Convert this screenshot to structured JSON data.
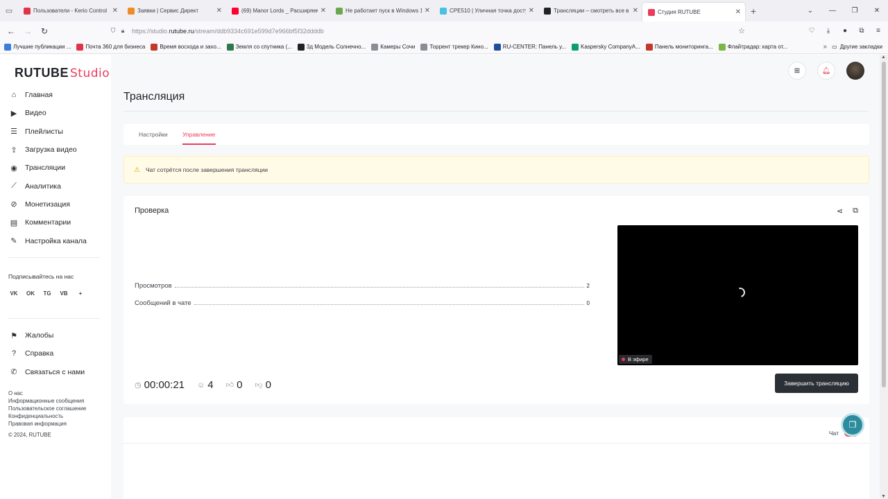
{
  "browser": {
    "tabs": [
      {
        "title": "Пользователи - Kerio Control",
        "color": "#e0334a"
      },
      {
        "title": "Заявки | Сервис Директ",
        "color": "#f08c28"
      },
      {
        "title": "(69) Manor Lords _ Расширяем",
        "color": "#ff0033"
      },
      {
        "title": "Не работает пуск в Windows 1",
        "color": "#6aa84f"
      },
      {
        "title": "CPE510 | Уличная точка досту",
        "color": "#4ac1e0"
      },
      {
        "title": "Трансляции – смотреть все в",
        "color": "#1f2226"
      },
      {
        "title": "Студия RUTUBE",
        "color": "#ea3b5b",
        "active": true
      }
    ],
    "url_prefix": "https://studio.",
    "url_domain": "rutube.ru",
    "url_path": "/stream/ddb9334c691e599d7e966bf5f32ddddb",
    "bookmarks": [
      {
        "label": "Лучшие публикации ...",
        "color": "#3b7dd8"
      },
      {
        "label": "Почта 360 для бизнеса",
        "color": "#e0334a"
      },
      {
        "label": "Время восхода и захо...",
        "color": "#c0392b"
      },
      {
        "label": "Земля со спутника (...",
        "color": "#2c7a4b"
      },
      {
        "label": "3д Модель Солнечно...",
        "color": "#1f2226"
      },
      {
        "label": "Камеры Сочи",
        "color": "#8a8d93"
      },
      {
        "label": "Торрент трекер Кино...",
        "color": "#8a8d93"
      },
      {
        "label": "RU-CENTER: Панель у...",
        "color": "#1c4e9a"
      },
      {
        "label": "Kaspersky CompanyA...",
        "color": "#0a9e6e"
      },
      {
        "label": "Панель мониторинга...",
        "color": "#c0392b"
      },
      {
        "label": "Флайтрадар: карта от...",
        "color": "#7ab648"
      }
    ],
    "other_bookmarks": "Другие закладки"
  },
  "logo": {
    "part1": "RUTUBE",
    "part2": "Studio"
  },
  "sidebar": {
    "menu": [
      {
        "label": "Главная",
        "icon": "home-icon"
      },
      {
        "label": "Видео",
        "icon": "video-icon"
      },
      {
        "label": "Плейлисты",
        "icon": "playlist-icon"
      },
      {
        "label": "Загрузка видео",
        "icon": "upload-icon"
      },
      {
        "label": "Трансляции",
        "icon": "broadcast-icon"
      },
      {
        "label": "Аналитика",
        "icon": "analytics-icon"
      },
      {
        "label": "Монетизация",
        "icon": "money-icon"
      },
      {
        "label": "Комментарии",
        "icon": "comments-icon"
      },
      {
        "label": "Настройка канала",
        "icon": "wand-icon"
      }
    ],
    "social_title": "Подписывайтесь на нас",
    "socials": [
      "VK",
      "OK",
      "TG",
      "VB",
      "+"
    ],
    "menu2": [
      {
        "label": "Жалобы",
        "icon": "flag-icon"
      },
      {
        "label": "Справка",
        "icon": "help-icon"
      },
      {
        "label": "Связаться с нами",
        "icon": "contact-icon"
      }
    ],
    "footer_links": [
      "О нас",
      "Информационные сообщения",
      "Пользовательское соглашение",
      "Конфиденциальность",
      "Правовая информация"
    ],
    "copyright": "© 2024, RUTUBE"
  },
  "page": {
    "title": "Трансляция",
    "tabs": [
      {
        "label": "Настройки"
      },
      {
        "label": "Управление",
        "active": true
      }
    ],
    "warning": "Чат сотрётся после завершения трансляции",
    "card_title": "Проверка",
    "stats": [
      {
        "label": "Просмотров",
        "value": "2"
      },
      {
        "label": "Сообщений в чате",
        "value": "0"
      }
    ],
    "live_badge": "В эфире",
    "timer": "00:00:21",
    "viewers": "4",
    "likes": "0",
    "dislikes": "0",
    "end_button": "Завершить трансляцию",
    "chat_label": "Чат",
    "chat_enabled": true
  },
  "colors": {
    "accent": "#ea3b5b",
    "dark_button": "#2b2f36",
    "warning_bg": "#fffbe6",
    "fab": "#2c8c9d"
  }
}
